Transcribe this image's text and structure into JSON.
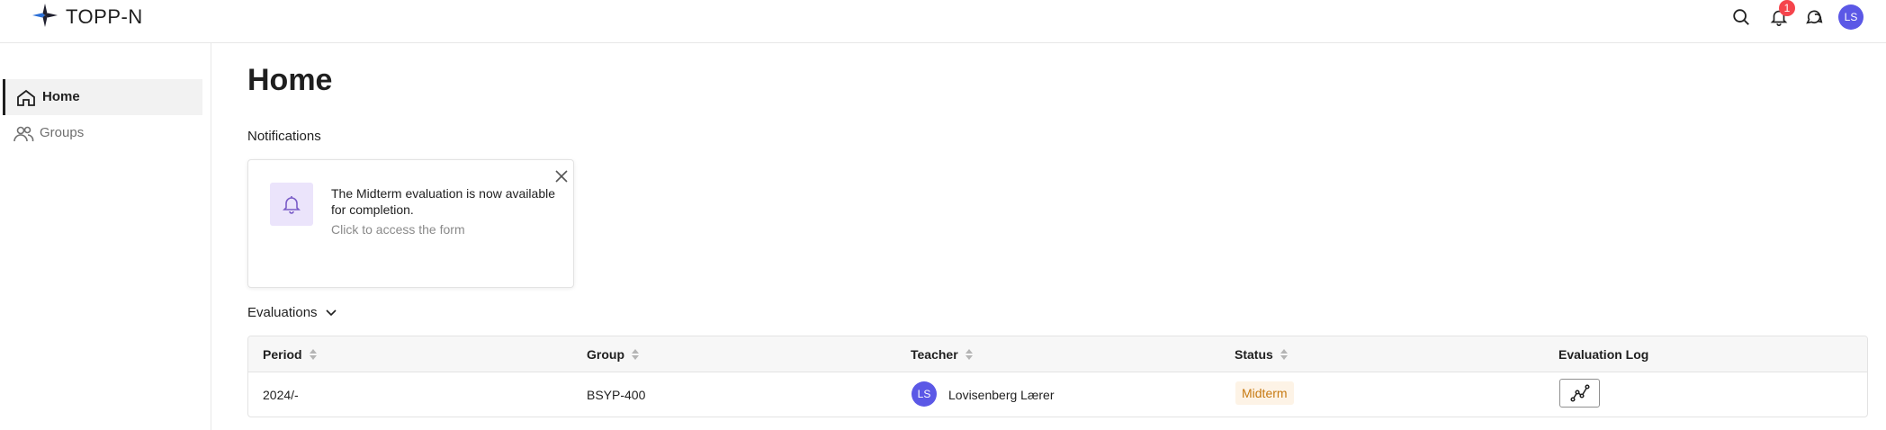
{
  "header": {
    "brand": "TOPP-N",
    "notification_count": "1",
    "avatar_initials": "LS",
    "icons": [
      "logo-icon",
      "search-icon",
      "bell-icon",
      "chat-icon"
    ]
  },
  "sidebar": {
    "items": [
      {
        "label": "Home",
        "icon": "home-icon",
        "active": true
      },
      {
        "label": "Groups",
        "icon": "users-icon",
        "active": false
      }
    ]
  },
  "main": {
    "title": "Home",
    "notifications_label": "Notifications",
    "notification": {
      "title": "The Midterm evaluation is now available for completion.",
      "subtitle": "Click to access the form",
      "icon": "bell-icon"
    },
    "evaluations_label": "Evaluations",
    "table": {
      "headers": [
        "Period",
        "Group",
        "Teacher",
        "Status",
        "Evaluation Log"
      ],
      "rows": [
        {
          "period": "2024/-",
          "group": "BSYP-400",
          "teacher_initials": "LS",
          "teacher": "Lovisenberg Lærer",
          "status": "Midterm"
        }
      ]
    }
  },
  "colors": {
    "accent": "#5b58e6",
    "badge": "#f5444c",
    "status_text": "#c77a12",
    "status_bg": "#fdf3e6",
    "notif_icon_bg": "#ebe4fb"
  }
}
